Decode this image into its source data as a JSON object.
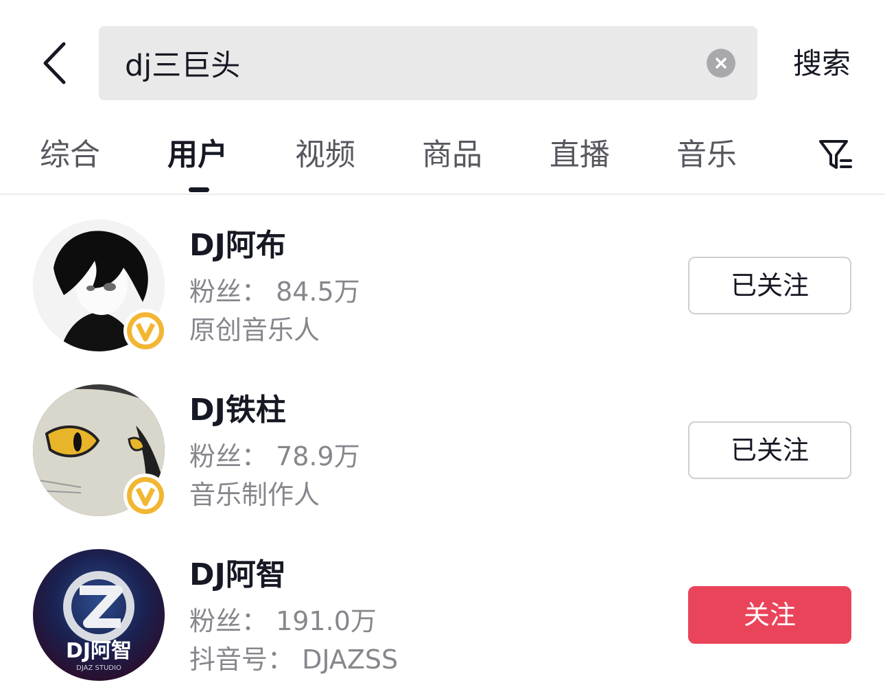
{
  "search": {
    "query": "dj三巨头",
    "submit_label": "搜索"
  },
  "tabs": [
    {
      "label": "综合",
      "active": false
    },
    {
      "label": "用户",
      "active": true
    },
    {
      "label": "视频",
      "active": false
    },
    {
      "label": "商品",
      "active": false
    },
    {
      "label": "直播",
      "active": false
    },
    {
      "label": "音乐",
      "active": false
    }
  ],
  "users": [
    {
      "name": "DJ阿布",
      "fans": "粉丝： 84.5万",
      "desc": "原创音乐人",
      "verified": true,
      "follow_label": "已关注",
      "following": true
    },
    {
      "name": "DJ铁柱",
      "fans": "粉丝： 78.9万",
      "desc": "音乐制作人",
      "verified": true,
      "follow_label": "已关注",
      "following": true
    },
    {
      "name": "DJ阿智",
      "fans": "粉丝： 191.0万",
      "desc": "抖音号： DJAZSS",
      "verified": false,
      "follow_label": "关注",
      "following": false,
      "avatar_text": "DJ阿智",
      "avatar_subtext": "DJAZ STUDIO"
    }
  ],
  "colors": {
    "accent": "#ea445a",
    "badge": "#f2b632",
    "text_primary": "#161823",
    "text_secondary": "#86878c"
  }
}
